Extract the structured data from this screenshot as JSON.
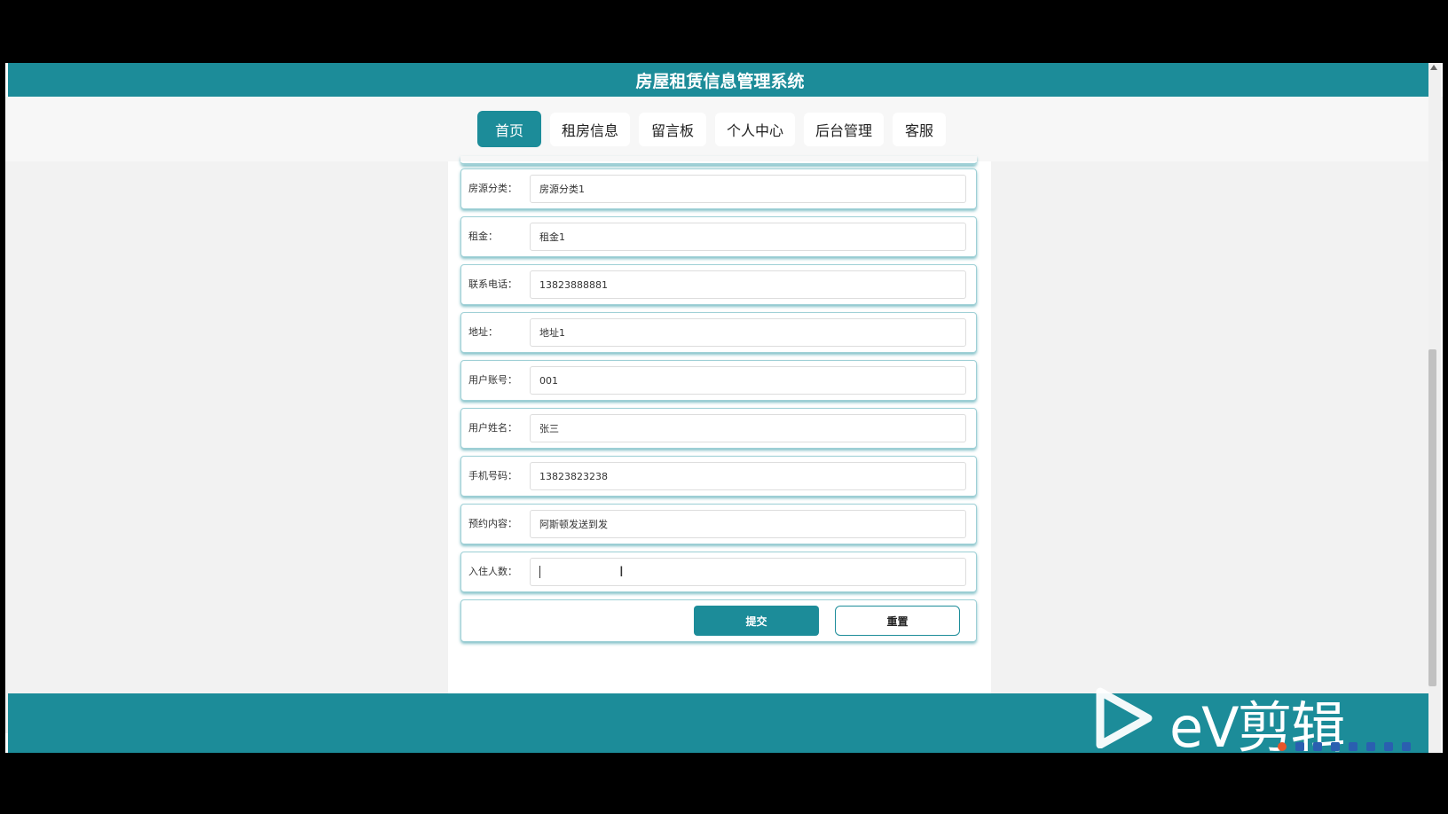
{
  "app": {
    "title": "房屋租赁信息管理系统"
  },
  "nav": {
    "items": [
      {
        "label": "首页",
        "active": true
      },
      {
        "label": "租房信息"
      },
      {
        "label": "留言板"
      },
      {
        "label": "个人中心"
      },
      {
        "label": "后台管理"
      },
      {
        "label": "客服"
      }
    ]
  },
  "form": {
    "fields": [
      {
        "label": "房源分类：",
        "value": "房源分类1"
      },
      {
        "label": "租金：",
        "value": "租金1"
      },
      {
        "label": "联系电话：",
        "value": "13823888881"
      },
      {
        "label": "地址：",
        "value": "地址1"
      },
      {
        "label": "用户账号：",
        "value": "001"
      },
      {
        "label": "用户姓名：",
        "value": "张三"
      },
      {
        "label": "手机号码：",
        "value": "13823823238"
      },
      {
        "label": "预约内容：",
        "value": "阿斯顿发送到发"
      },
      {
        "label": "入住人数：",
        "value": ""
      }
    ],
    "submit_label": "提交",
    "reset_label": "重置"
  },
  "watermark": {
    "text": "eV剪辑"
  },
  "colors": {
    "accent": "#1c8c99"
  }
}
